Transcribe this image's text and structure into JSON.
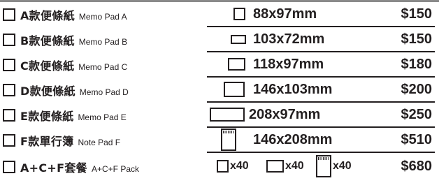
{
  "products": [
    {
      "name_zh": "A款便條紙",
      "name_en": "Memo Pad A",
      "size": "88x97mm",
      "price": "$150",
      "icon": "memo-pad-icon"
    },
    {
      "name_zh": "B款便條紙",
      "name_en": "Memo Pad B",
      "size": "103x72mm",
      "price": "$150",
      "icon": "memo-pad-icon"
    },
    {
      "name_zh": "C款便條紙",
      "name_en": "Memo Pad C",
      "size": "118x97mm",
      "price": "$180",
      "icon": "memo-pad-icon"
    },
    {
      "name_zh": "D款便條紙",
      "name_en": "Memo Pad D",
      "size": "146x103mm",
      "price": "$200",
      "icon": "memo-pad-icon"
    },
    {
      "name_zh": "E款便條紙",
      "name_en": "Memo Pad E",
      "size": "208x97mm",
      "price": "$250",
      "icon": "memo-pad-icon"
    },
    {
      "name_zh": "F款單行簿",
      "name_en": "Note Pad F",
      "size": "146x208mm",
      "price": "$510",
      "icon": "spiral-notepad-icon"
    }
  ],
  "pack": {
    "name_zh": "A+C+F套餐",
    "name_en": "A+C+F Pack",
    "items": [
      {
        "icon": "memo-pad-icon",
        "qty": "x40"
      },
      {
        "icon": "memo-pad-icon",
        "qty": "x40"
      },
      {
        "icon": "spiral-notepad-icon",
        "qty": "x40"
      }
    ],
    "price": "$680"
  },
  "colors": {
    "text": "#231f20",
    "top_bar": "#8a8a8a",
    "background": "#ffffff"
  }
}
